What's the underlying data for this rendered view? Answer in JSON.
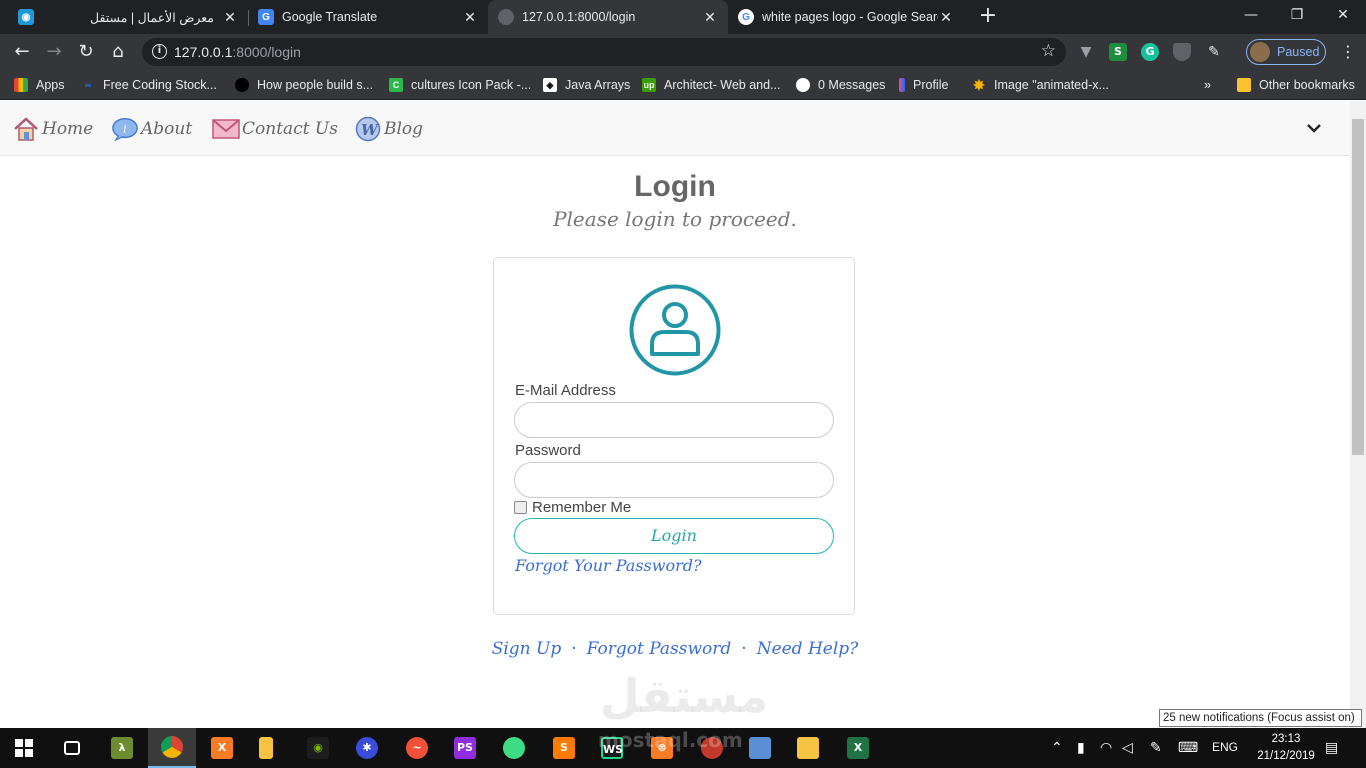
{
  "browser": {
    "tabs": [
      {
        "title": "معرض الأعمال | مستقل",
        "favicon": "mostaql-icon",
        "color": "#1e9bd7",
        "active": false
      },
      {
        "title": "Google Translate",
        "favicon": "translate-icon",
        "color": "#4285f4",
        "active": false
      },
      {
        "title": "127.0.0.1:8000/login",
        "favicon": "globe-icon",
        "color": "#5f6368",
        "active": true
      },
      {
        "title": "white pages logo - Google Searc",
        "favicon": "google-icon",
        "color": "#ffffff",
        "active": false
      }
    ],
    "url_host": "127.0.0.1",
    "url_path": ":8000/login",
    "profile_label": "Paused",
    "extensions": [
      "vue-icon",
      "s-icon",
      "grammarly-icon",
      "shield-icon",
      "pen-icon"
    ],
    "bookmarks": [
      {
        "label": "Apps",
        "icon": "apps-grid-icon",
        "color": "#e94235"
      },
      {
        "label": "Free Coding Stock...",
        "icon": "infinity-icon",
        "color": "#1a73e8"
      },
      {
        "label": "How people build s...",
        "icon": "github-icon",
        "color": "#000000"
      },
      {
        "label": "cultures Icon Pack -...",
        "icon": "cultures-icon",
        "color": "#2db84c"
      },
      {
        "label": "Java Arrays",
        "icon": "w3-icon",
        "color": "#ffffff"
      },
      {
        "label": "Architect- Web and...",
        "icon": "upwork-icon",
        "color": "#37a000"
      },
      {
        "label": "0 Messages",
        "icon": "messages-icon",
        "color": "#ffffff"
      },
      {
        "label": "Profile",
        "icon": "behance-icon",
        "color": "#ea4c89"
      },
      {
        "label": "Image \"animated-x...",
        "icon": "star-burst-icon",
        "color": "#f4b400"
      }
    ],
    "other_bookmarks": "Other bookmarks"
  },
  "site": {
    "nav": [
      {
        "label": "Home",
        "icon": "house-icon"
      },
      {
        "label": "About",
        "icon": "info-bubble-icon"
      },
      {
        "label": "Contact Us",
        "icon": "mail-icon"
      },
      {
        "label": "Blog",
        "icon": "wordpress-icon"
      }
    ],
    "title": "Login",
    "subtitle": "Please login to proceed.",
    "form": {
      "email_label": "E-Mail Address",
      "email_value": "",
      "password_label": "Password",
      "password_value": "",
      "remember_label": "Remember Me",
      "remember_checked": false,
      "submit_label": "Login",
      "forgot_label": "Forgot Your Password?"
    },
    "footer_links": [
      "Sign Up",
      "Forgot Password",
      "Need Help?"
    ],
    "footer_separator": "·"
  },
  "watermark": {
    "arabic": "مستقل",
    "latin": "mostaql.com"
  },
  "notification": "25 new notifications (Focus assist on)",
  "taskbar": {
    "apps": [
      "lambda-icon",
      "chrome-icon",
      "xampp-icon",
      "file-icon",
      "nvidia-icon",
      "network-icon",
      "swift-icon",
      "phpstorm-icon",
      "android-studio-icon",
      "sublime-icon",
      "webstorm-icon",
      "xampp-panel-icon",
      "spyder-icon",
      "monitor-icon",
      "file-explorer-icon",
      "excel-icon"
    ],
    "language": "ENG",
    "time": "23:13",
    "date": "21/12/2019"
  }
}
